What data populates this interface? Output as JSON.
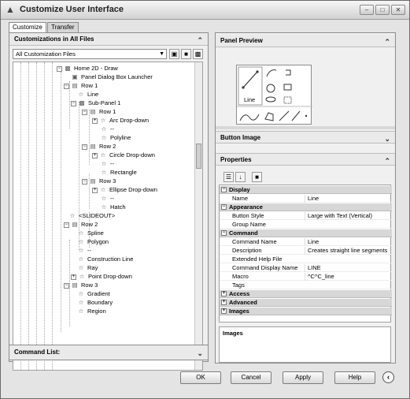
{
  "window": {
    "title": "Customize User Interface"
  },
  "tabs": [
    "Customize",
    "Transfer"
  ],
  "left_panel": {
    "header": "Customizations in All Files",
    "files_combo": "All Customization Files",
    "tree": [
      "Home 2D - Draw",
      "Panel Dialog Box Launcher",
      "Row 1",
      "Line",
      "Sub-Panel 1",
      "Row 1",
      "Arc Drop-down",
      "--",
      "Polyline",
      "Row 2",
      "Circle Drop-down",
      "--",
      "Rectangle",
      "Row 3",
      "Ellipse Drop-down",
      "--",
      "Hatch",
      "<SLIDEOUT>",
      "Row 2",
      "Spline",
      "Polygon",
      "--",
      "Construction Line",
      "Ray",
      "Point Drop-down",
      "Row 3",
      "Gradient",
      "Boundary",
      "Region"
    ]
  },
  "command_list": {
    "header": "Command List:"
  },
  "right_panel": {
    "panel_preview_header": "Panel Preview",
    "preview_line_label": "Line",
    "button_image_header": "Button Image",
    "properties_header": "Properties",
    "properties": [
      {
        "category": "Display",
        "rows": [
          {
            "name": "Name",
            "value": "Line"
          }
        ]
      },
      {
        "category": "Appearance",
        "rows": [
          {
            "name": "Button Style",
            "value": "Large with Text (Vertical)"
          },
          {
            "name": "Group Name",
            "value": ""
          }
        ]
      },
      {
        "category": "Command",
        "rows": [
          {
            "name": "Command Name",
            "value": "Line"
          },
          {
            "name": "Description",
            "value": "Creates straight line segments"
          },
          {
            "name": "Extended Help File",
            "value": ""
          },
          {
            "name": "Command Display Name",
            "value": "LINE"
          },
          {
            "name": "Macro",
            "value": "^C^C_line"
          },
          {
            "name": "Tags",
            "value": ""
          }
        ]
      },
      {
        "category": "Access",
        "rows": []
      },
      {
        "category": "Advanced",
        "rows": []
      },
      {
        "category": "Images",
        "rows": []
      }
    ],
    "description_title": "Images"
  },
  "footer_buttons": {
    "ok": "OK",
    "cancel": "Cancel",
    "apply": "Apply",
    "help": "Help"
  },
  "icons": {
    "window": "autocad-app-icon",
    "collapse": "double-chevron-up-icon",
    "expand": "double-chevron-down-icon",
    "command": "star-icon",
    "row": "row-icon",
    "help_back": "circle-left-arrow-icon"
  }
}
